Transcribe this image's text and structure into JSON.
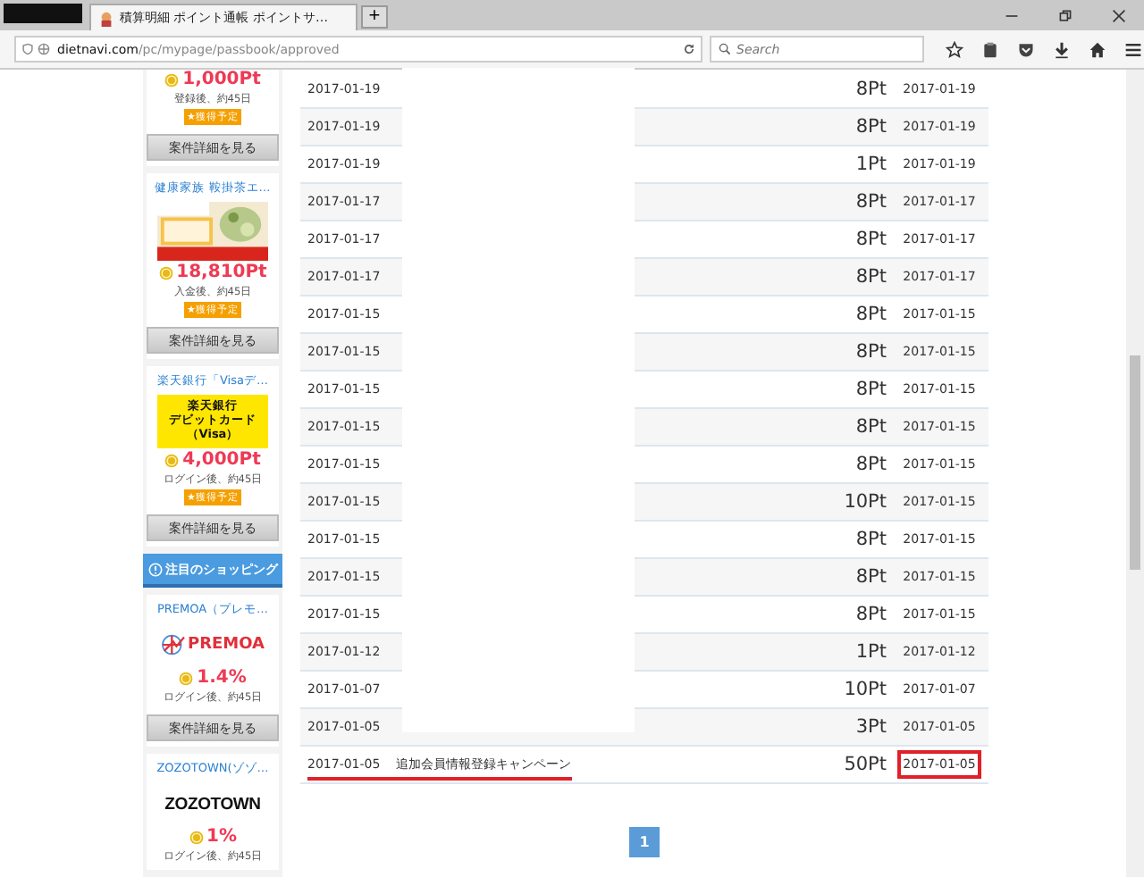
{
  "browser": {
    "tab_title": "積算明細 ポイント通帳 ポイントサ…",
    "new_tab": "+",
    "url_host": "dietnavi.com",
    "url_path": "/pc/mypage/passbook/approved",
    "search": {
      "placeholder": "Search"
    }
  },
  "sidebar": [
    {
      "kind": "offer",
      "points": "1,000Pt",
      "condition": "登録後、約45日",
      "badge": "★獲得予定",
      "button": "案件詳細を見る"
    },
    {
      "kind": "offer",
      "title": "健康家族 鞍掛茶エ…",
      "points": "18,810Pt",
      "condition": "入金後、約45日",
      "badge": "★獲得予定",
      "button": "案件詳細を見る"
    },
    {
      "kind": "offer",
      "title": "楽天銀行「Visaデ…",
      "banner": {
        "kind": "text",
        "lines": [
          "楽天銀行",
          "デビットカード",
          "（Visa）"
        ]
      },
      "points": "4,000Pt",
      "condition": "ログイン後、約45日",
      "badge": "★獲得予定",
      "button": "案件詳細を見る"
    },
    {
      "kind": "section",
      "label": "注目のショッピング"
    },
    {
      "kind": "offer",
      "title": "PREMOA（プレモ…",
      "banner": {
        "kind": "globe-logo",
        "text": "PREMOA"
      },
      "points": "1.4%",
      "condition": "ログイン後、約45日",
      "button": "案件詳細を見る"
    },
    {
      "kind": "offer",
      "title": "ZOZOTOWN(ゾゾ…",
      "banner": {
        "kind": "logo",
        "text": "ZOZOTOWN"
      },
      "points": "1%",
      "condition": "ログイン後、約45日"
    }
  ],
  "table": {
    "rows": [
      {
        "date": "2017-01-19",
        "points": "8Pt",
        "settled": "2017-01-19",
        "underlined": false,
        "boxed": false
      },
      {
        "date": "2017-01-19",
        "points": "8Pt",
        "settled": "2017-01-19",
        "underlined": false,
        "boxed": false
      },
      {
        "date": "2017-01-19",
        "points": "1Pt",
        "settled": "2017-01-19",
        "underlined": false,
        "boxed": false
      },
      {
        "date": "2017-01-17",
        "points": "8Pt",
        "settled": "2017-01-17",
        "underlined": false,
        "boxed": false
      },
      {
        "date": "2017-01-17",
        "points": "8Pt",
        "settled": "2017-01-17",
        "underlined": false,
        "boxed": false
      },
      {
        "date": "2017-01-17",
        "points": "8Pt",
        "settled": "2017-01-17",
        "underlined": false,
        "boxed": false
      },
      {
        "date": "2017-01-15",
        "points": "8Pt",
        "settled": "2017-01-15",
        "underlined": false,
        "boxed": false
      },
      {
        "date": "2017-01-15",
        "points": "8Pt",
        "settled": "2017-01-15",
        "underlined": false,
        "boxed": false
      },
      {
        "date": "2017-01-15",
        "points": "8Pt",
        "settled": "2017-01-15",
        "underlined": false,
        "boxed": false
      },
      {
        "date": "2017-01-15",
        "points": "8Pt",
        "settled": "2017-01-15",
        "underlined": false,
        "boxed": false
      },
      {
        "date": "2017-01-15",
        "points": "8Pt",
        "settled": "2017-01-15",
        "underlined": false,
        "boxed": false
      },
      {
        "date": "2017-01-15",
        "points": "10Pt",
        "settled": "2017-01-15",
        "underlined": false,
        "boxed": false
      },
      {
        "date": "2017-01-15",
        "points": "8Pt",
        "settled": "2017-01-15",
        "underlined": false,
        "boxed": false
      },
      {
        "date": "2017-01-15",
        "points": "8Pt",
        "settled": "2017-01-15",
        "underlined": false,
        "boxed": false
      },
      {
        "date": "2017-01-15",
        "points": "8Pt",
        "settled": "2017-01-15",
        "underlined": false,
        "boxed": false
      },
      {
        "date": "2017-01-12",
        "points": "1Pt",
        "settled": "2017-01-12",
        "underlined": false,
        "boxed": false
      },
      {
        "date": "2017-01-07",
        "points": "10Pt",
        "settled": "2017-01-07",
        "underlined": false,
        "boxed": false
      },
      {
        "date": "2017-01-05",
        "points": "3Pt",
        "settled": "2017-01-05",
        "underlined": false,
        "boxed": false
      },
      {
        "date": "2017-01-05",
        "description": "追加会員情報登録キャンペーン",
        "points": "50Pt",
        "settled": "2017-01-05",
        "underlined": true,
        "boxed": true
      }
    ]
  },
  "pagination": [
    {
      "label": "1",
      "selected": true
    }
  ]
}
